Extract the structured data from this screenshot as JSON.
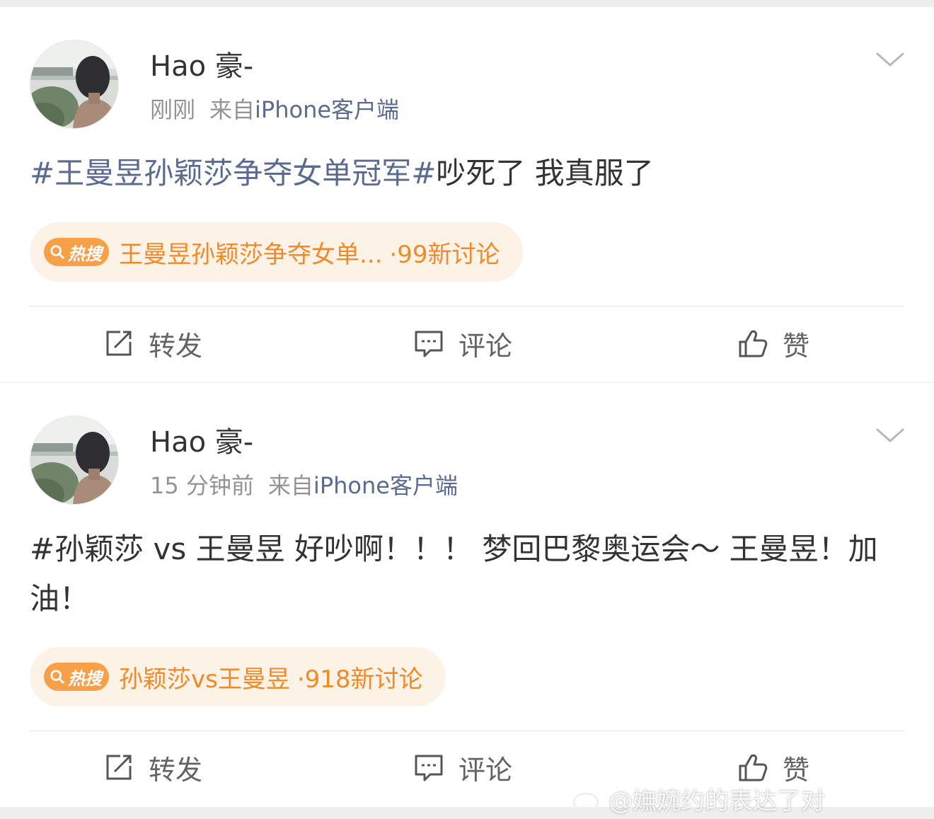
{
  "posts": [
    {
      "username": "Hao 豪-",
      "time": "刚刚",
      "source_prefix": "来自",
      "source": "iPhone客户端",
      "content": {
        "topic": "#王曼昱孙颖莎争夺女单冠军#",
        "text": "吵死了 我真服了"
      },
      "hot_search": {
        "badge": "热搜",
        "title": "王曼昱孙颖莎争夺女单...",
        "count": "·99新讨论"
      },
      "actions": {
        "repost": "转发",
        "comment": "评论",
        "like": "赞"
      }
    },
    {
      "username": "Hao 豪-",
      "time": "15 分钟前",
      "source_prefix": "来自",
      "source": "iPhone客户端",
      "content": {
        "topic": "",
        "text": "#孙颖莎 vs 王曼昱 好吵啊！！！ 梦回巴黎奥运会～ 王曼昱！加油！"
      },
      "hot_search": {
        "badge": "热搜",
        "title": "孙颖莎vs王曼昱",
        "count": "·918新讨论"
      },
      "actions": {
        "repost": "转发",
        "comment": "评论",
        "like": "赞"
      }
    }
  ],
  "watermark": "@嫵婉约的表达了对",
  "colors": {
    "topic_link": "#5b6b90",
    "hot_accent": "#ee8a2a",
    "hot_badge": "#f7a048",
    "hot_pill_bg": "#fdf2e6"
  },
  "icons": [
    "avatar-photo",
    "chevron-down-icon",
    "search-icon",
    "repost-icon",
    "comment-icon",
    "like-icon",
    "weibo-logo-icon"
  ]
}
